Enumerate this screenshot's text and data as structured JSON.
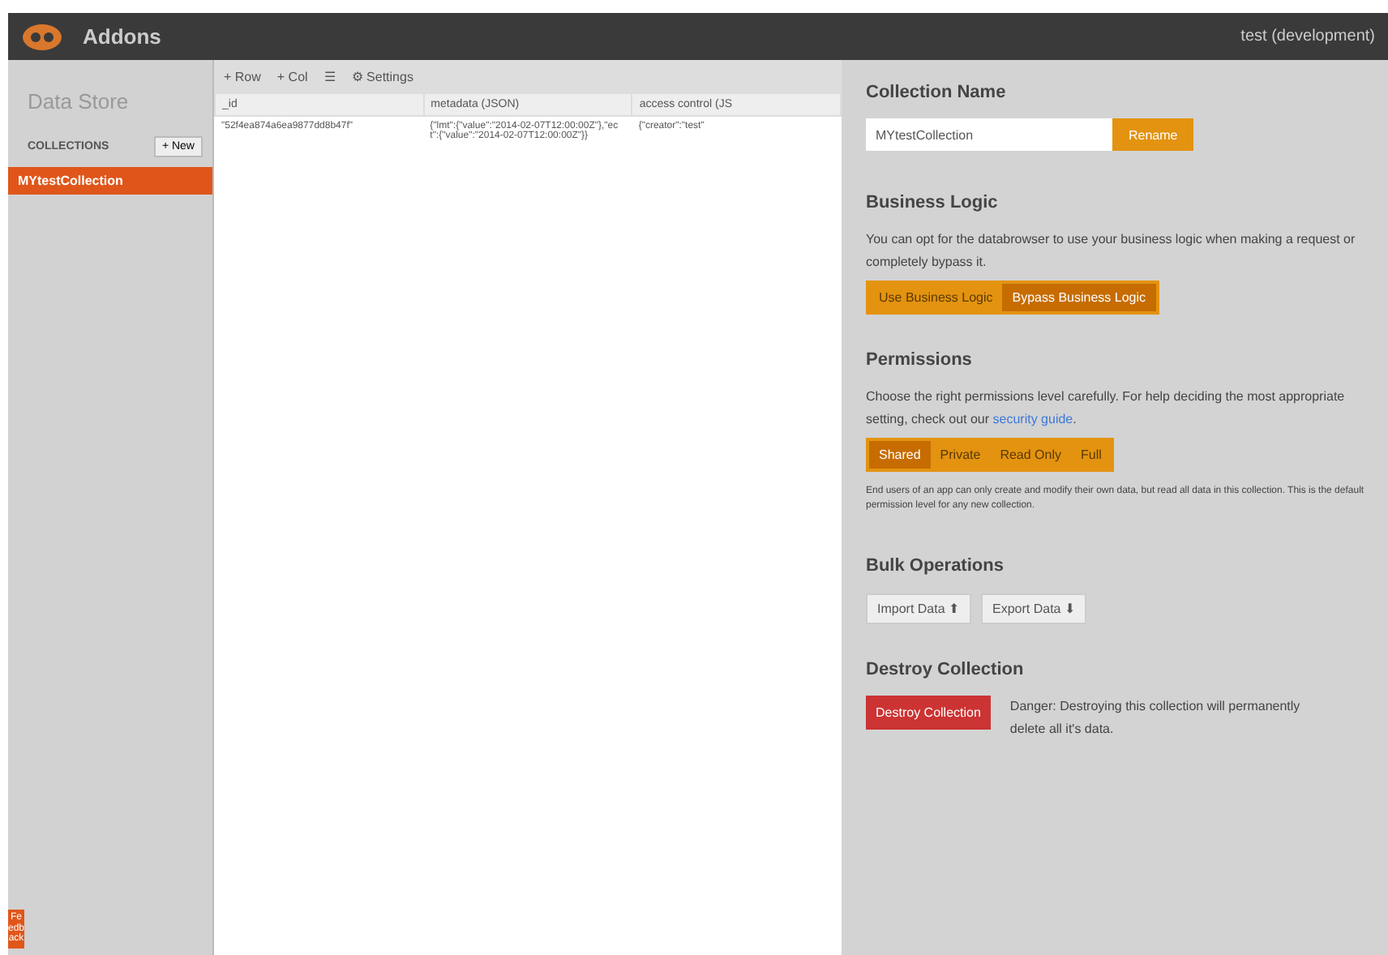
{
  "topbar": {
    "title": "Addons",
    "environment": "test (development)"
  },
  "sidebar": {
    "title": "Data Store",
    "section": "COLLECTIONS",
    "new_button": "+ New",
    "items": [
      {
        "label": "MYtestCollection",
        "selected": true
      }
    ],
    "feedback": "Feedback"
  },
  "toolbar": [
    "+ Row",
    "+ Col",
    "☰",
    "⚙ Settings"
  ],
  "table": {
    "columns": [
      "_id",
      "metadata (JSON)",
      "access control (JS"
    ],
    "rows": [
      [
        "\"52f4ea874a6ea9877dd8b47f\"",
        "{\"lmt\":{\"value\":\"2014-02-07T12:00:00Z\"},\"ect\":{\"value\":\"2014-02-07T12:00:00Z\"}}",
        "{\"creator\":\"test\""
      ]
    ]
  },
  "panel": {
    "name_heading": "Collection Name",
    "name_value": "MYtestCollection",
    "rename": "Rename",
    "logic_heading": "Business Logic",
    "logic_text": "You can opt for the databrowser to use your business logic when making a request or completely bypass it.",
    "logic_options": [
      {
        "label": "Use Business Logic",
        "selected": false
      },
      {
        "label": "Bypass Business Logic",
        "selected": true
      }
    ],
    "perm_heading": "Permissions",
    "perm_text_before": "Choose the right permissions level carefully. For help deciding the most appropriate setting, check out our ",
    "perm_link": "security guide",
    "perm_text_after": ".",
    "perm_options": [
      {
        "label": "Shared",
        "selected": true
      },
      {
        "label": "Private",
        "selected": false
      },
      {
        "label": "Read Only",
        "selected": false
      },
      {
        "label": "Full",
        "selected": false
      }
    ],
    "perm_note": "End users of an app can only create and modify their own data, but read all data in this collection. This is the default permission level for any new collection.",
    "bulk_heading": "Bulk Operations",
    "bulk_buttons": [
      "Import Data ⬆",
      "Export Data ⬇"
    ],
    "destroy_heading": "Destroy Collection",
    "destroy_button": "Destroy Collection",
    "destroy_text": "Danger: Destroying this collection will permanently delete all it's data."
  }
}
